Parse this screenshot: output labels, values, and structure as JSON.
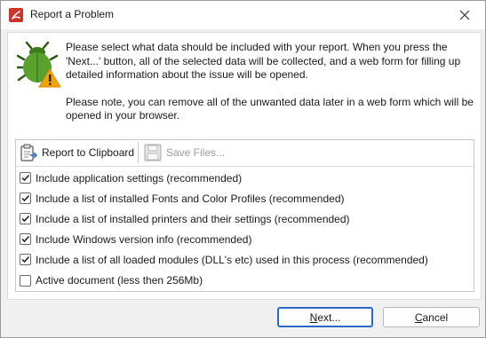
{
  "window": {
    "title": "Report a Problem"
  },
  "message": {
    "paragraph1": "Please select what data should be included with your report. When you press the 'Next...' button, all of the selected data will be collected, and a web form for filling up detailed information about the issue will be opened.",
    "paragraph2": "Please note, you can remove all of the unwanted data later in a web form which will be opened in your browser."
  },
  "toolbar": {
    "clipboard_label": "Report to Clipboard",
    "save_label": "Save Files..."
  },
  "options": [
    {
      "label": "Include application settings (recommended)",
      "checked": true
    },
    {
      "label": "Include a list of installed Fonts and Color Profiles (recommended)",
      "checked": true
    },
    {
      "label": "Include a list of installed printers and their settings (recommended)",
      "checked": true
    },
    {
      "label": "Include Windows version info (recommended)",
      "checked": true
    },
    {
      "label": "Include a list of all loaded modules (DLL's etc) used in this process (recommended)",
      "checked": true
    },
    {
      "label": "Active document (less then 256Mb)",
      "checked": false
    }
  ],
  "buttons": {
    "next_prefix": "",
    "next_mnemonic": "N",
    "next_rest": "ext...",
    "cancel_prefix": "",
    "cancel_mnemonic": "C",
    "cancel_rest": "ancel"
  },
  "colors": {
    "accent": "#2b69c7",
    "app_icon": "#c8362a",
    "bug_green": "#5aa22e",
    "warning": "#f0a30a"
  },
  "icons": {
    "app": "pdf-app-icon",
    "close": "close-icon",
    "bug": "bug-warning-icon",
    "clipboard": "clipboard-icon",
    "save": "floppy-disk-icon",
    "check": "checkmark-icon"
  }
}
